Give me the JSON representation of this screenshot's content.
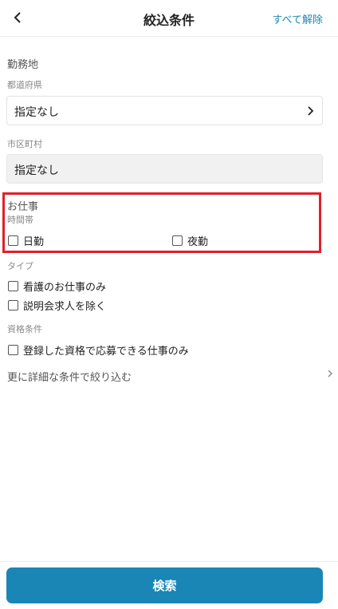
{
  "header": {
    "title": "絞込条件",
    "clear_all_label": "すべて解除"
  },
  "work_location": {
    "heading": "勤務地",
    "prefecture": {
      "label": "都道府県",
      "value": "指定なし"
    },
    "city": {
      "label": "市区町村",
      "value": "指定なし"
    }
  },
  "job": {
    "heading": "お仕事",
    "time_slot": {
      "label": "時間帯",
      "options": [
        {
          "label": "日勤",
          "checked": false
        },
        {
          "label": "夜勤",
          "checked": false
        }
      ]
    }
  },
  "type": {
    "heading": "タイプ",
    "options": [
      {
        "label": "看護のお仕事のみ",
        "checked": false
      },
      {
        "label": "説明会求人を除く",
        "checked": false
      }
    ]
  },
  "qualification": {
    "heading": "資格条件",
    "options": [
      {
        "label": "登録した資格で応募できる仕事のみ",
        "checked": false
      }
    ]
  },
  "more_conditions_label": "更に詳細な条件で絞り込む",
  "search_button_label": "検索",
  "colors": {
    "accent": "#1a86b5",
    "link": "#1f86b3",
    "highlight": "#e0202a"
  }
}
